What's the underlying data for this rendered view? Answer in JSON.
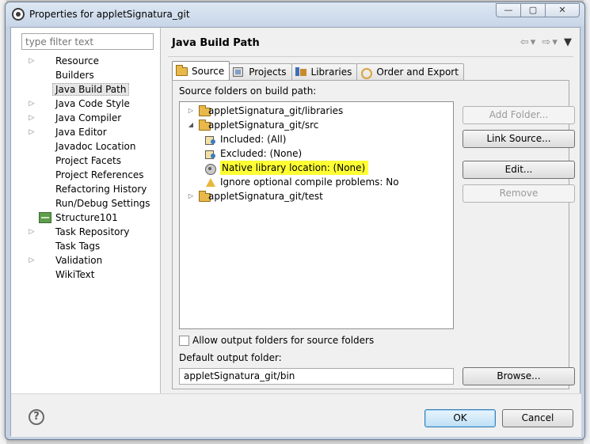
{
  "window": {
    "title": "Properties for appletSignatura_git",
    "controls": {
      "minimize": "—",
      "restore": "▢",
      "close": "✕"
    }
  },
  "sidebar": {
    "filter_placeholder": "type filter text",
    "items": [
      {
        "label": "Resource",
        "expandable": true
      },
      {
        "label": "Builders",
        "expandable": false
      },
      {
        "label": "Java Build Path",
        "expandable": false,
        "selected": true
      },
      {
        "label": "Java Code Style",
        "expandable": true
      },
      {
        "label": "Java Compiler",
        "expandable": true
      },
      {
        "label": "Java Editor",
        "expandable": true
      },
      {
        "label": "Javadoc Location",
        "expandable": false
      },
      {
        "label": "Project Facets",
        "expandable": false
      },
      {
        "label": "Project References",
        "expandable": false
      },
      {
        "label": "Refactoring History",
        "expandable": false
      },
      {
        "label": "Run/Debug Settings",
        "expandable": false
      },
      {
        "label": "Structure101",
        "expandable": false,
        "icon": "structure101-icon"
      },
      {
        "label": "Task Repository",
        "expandable": true
      },
      {
        "label": "Task Tags",
        "expandable": false
      },
      {
        "label": "Validation",
        "expandable": true
      },
      {
        "label": "WikiText",
        "expandable": false
      }
    ]
  },
  "main": {
    "title": "Java Build Path",
    "nav": {
      "back": "⇦",
      "forward": "⇨",
      "dropdown": "▾",
      "menu": "▼"
    },
    "tabs": [
      {
        "label": "Source",
        "active": true
      },
      {
        "label": "Projects",
        "active": false
      },
      {
        "label": "Libraries",
        "active": false
      },
      {
        "label": "Order and Export",
        "active": false
      }
    ],
    "source_folders_label": "Source folders on build path:",
    "tree": [
      {
        "label": "appletSignatura_git/libraries",
        "level": 0,
        "expander": "▷"
      },
      {
        "label": "appletSignatura_git/src",
        "level": 0,
        "expander": "◢"
      },
      {
        "label": "Included: (All)",
        "level": 1
      },
      {
        "label": "Excluded: (None)",
        "level": 1
      },
      {
        "label": "Native library location: (None)",
        "level": 1,
        "highlighted": true
      },
      {
        "label": "Ignore optional compile problems: No",
        "level": 1
      },
      {
        "label": "appletSignatura_git/test",
        "level": 0,
        "expander": "▷"
      }
    ],
    "buttons": {
      "add_folder": "Add Folder...",
      "link_source": "Link Source...",
      "edit": "Edit...",
      "remove": "Remove"
    },
    "allow_output_label": "Allow output folders for source folders",
    "default_output_label": "Default output folder:",
    "default_output_value": "appletSignatura_git/bin",
    "browse": "Browse..."
  },
  "footer": {
    "help": "?",
    "ok": "OK",
    "cancel": "Cancel"
  },
  "colors": {
    "highlight": "#ffff33",
    "default_button": "#bfe0f6"
  }
}
